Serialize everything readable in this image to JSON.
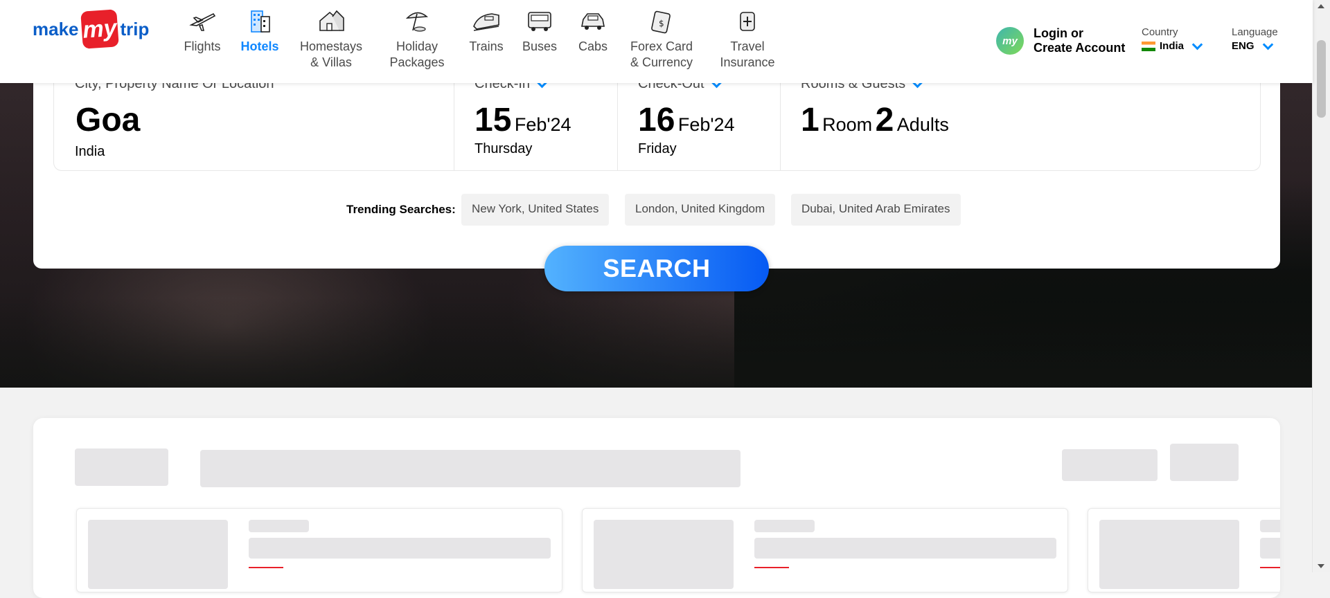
{
  "logo": {
    "part1": "make",
    "part2": "my",
    "part3": "trip"
  },
  "nav": {
    "items": [
      {
        "label": "Flights",
        "icon": "airplane-icon",
        "active": false
      },
      {
        "label": "Hotels",
        "icon": "hotel-icon",
        "active": true
      },
      {
        "label": "Homestays",
        "label2": "& Villas",
        "icon": "homestay-icon",
        "active": false
      },
      {
        "label": "Holiday",
        "label2": "Packages",
        "icon": "beach-umbrella-icon",
        "active": false
      },
      {
        "label": "Trains",
        "icon": "train-icon",
        "active": false
      },
      {
        "label": "Buses",
        "icon": "bus-icon",
        "active": false
      },
      {
        "label": "Cabs",
        "icon": "cab-icon",
        "active": false
      },
      {
        "label": "Forex Card",
        "label2": "& Currency",
        "icon": "forex-card-icon",
        "active": false
      },
      {
        "label": "Travel",
        "label2": "Insurance",
        "icon": "insurance-icon",
        "active": false
      }
    ]
  },
  "account": {
    "badge": "my",
    "line1": "Login or",
    "line2": "Create Account"
  },
  "country": {
    "label": "Country",
    "value": "India"
  },
  "language": {
    "label": "Language",
    "value": "ENG"
  },
  "search": {
    "city": {
      "label": "City, Property Name Or Location",
      "value": "Goa",
      "sub": "India"
    },
    "checkin": {
      "label": "Check-In",
      "day": "15",
      "monthyear": "Feb'24",
      "weekday": "Thursday"
    },
    "checkout": {
      "label": "Check-Out",
      "day": "16",
      "monthyear": "Feb'24",
      "weekday": "Friday"
    },
    "guests": {
      "label": "Rooms & Guests",
      "rooms": "1",
      "rooms_label": "Room",
      "adults": "2",
      "adults_label": "Adults"
    },
    "trending_label": "Trending Searches:",
    "trending": [
      "New York, United States",
      "London, United Kingdom",
      "Dubai, United Arab Emirates"
    ],
    "button": "SEARCH"
  },
  "colors": {
    "brand_blue": "#0b5ec8",
    "active_blue": "#0f87ff",
    "brand_red": "#e8202a"
  }
}
